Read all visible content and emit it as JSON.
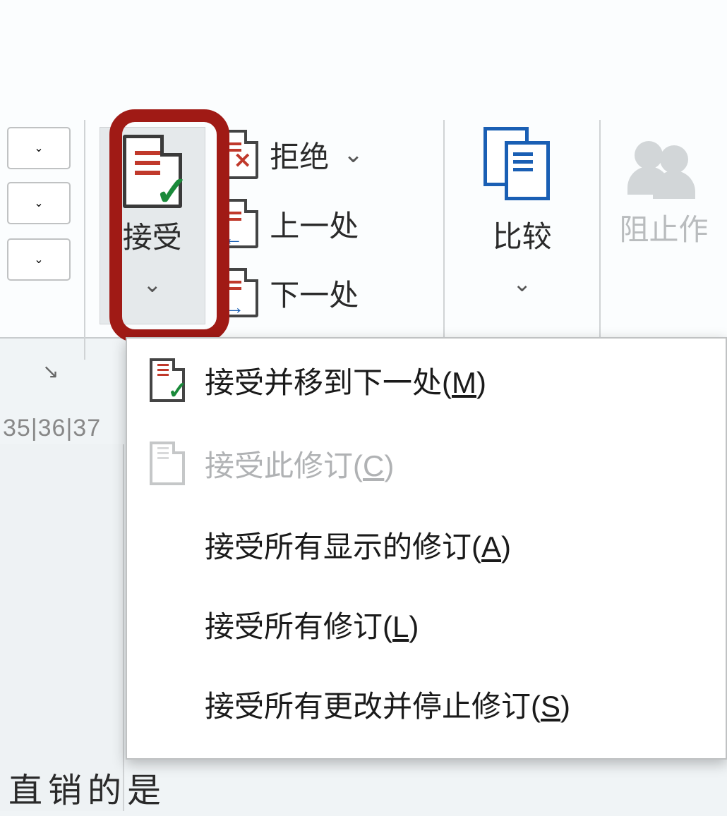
{
  "ribbon": {
    "accept": {
      "label": "接受"
    },
    "reject": {
      "label": "拒绝"
    },
    "previous": {
      "label": "上一处"
    },
    "next": {
      "label": "下一处"
    },
    "compare": {
      "label": "比较"
    },
    "protect": {
      "label": "阻止作"
    }
  },
  "ruler": {
    "marks": "35|36|37"
  },
  "menu": {
    "items": [
      {
        "prefix": "接受并移到下一处(",
        "key": "M",
        "suffix": ")",
        "disabled": false,
        "icon": true
      },
      {
        "prefix": "接受此修订(",
        "key": "C",
        "suffix": ")",
        "disabled": true,
        "icon": true
      },
      {
        "prefix": "接受所有显示的修订(",
        "key": "A",
        "suffix": ")",
        "disabled": false,
        "icon": false
      },
      {
        "prefix": "接受所有修订(",
        "key": "L",
        "suffix": ")",
        "disabled": false,
        "icon": false
      },
      {
        "prefix": "接受所有更改并停止修订(",
        "key": "S",
        "suffix": ")",
        "disabled": false,
        "icon": false
      }
    ]
  },
  "document": {
    "visible_text": "直销的是"
  }
}
